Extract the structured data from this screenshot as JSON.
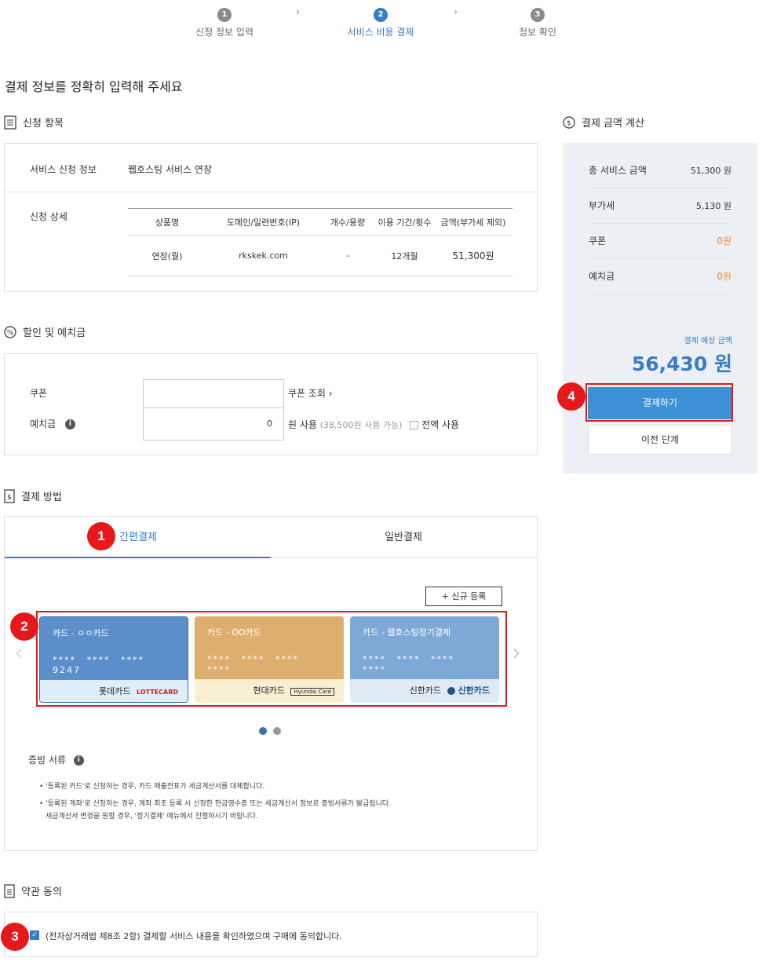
{
  "steps": [
    {
      "num": "1",
      "label": "신청 정보 입력"
    },
    {
      "num": "2",
      "label": "서비스 비용 결제"
    },
    {
      "num": "3",
      "label": "정보 확인"
    }
  ],
  "page_title": "결제 정보를 정확히 입력해 주세요",
  "sections": {
    "apply": "신청 항목",
    "discount": "할인 및 예치금",
    "method": "결제 방법",
    "terms": "약관 동의",
    "calc": "결제 금액 계산"
  },
  "apply": {
    "service_label": "서비스 신청 정보",
    "service_value": "웹호스팅 서비스 연장",
    "detail_label": "신청 상세",
    "columns": [
      "상품명",
      "도메인/일련번호(IP)",
      "개수/용량",
      "이용 기간/횟수",
      "금액(부가세 제외)"
    ],
    "row": [
      "연장(월)",
      "rkskek.com",
      "-",
      "12개월",
      "51,300원"
    ]
  },
  "discount": {
    "coupon_label": "쿠폰",
    "coupon_value": "",
    "coupon_lookup": "쿠폰 조회 ›",
    "deposit_label": "예치금",
    "deposit_value": "0",
    "deposit_use": "원 사용",
    "deposit_avail": "(38,500원 사용 가능)",
    "all_use": "전액 사용"
  },
  "method": {
    "tabs": [
      "간편결제",
      "일반결제"
    ],
    "new_register": "+ 신규 등록",
    "cards": [
      {
        "name": "카드 - ㅇㅇ카드",
        "number": "**** **** **** 9247",
        "issuer": "롯데카드",
        "brand": "LOTTECARD",
        "color": "#5b8fcb",
        "bottom": "#dfeefb"
      },
      {
        "name": "카드 - OO카드",
        "number": "**** **** **** ****",
        "issuer": "현대카드",
        "brand": "Hyundai Card",
        "color": "#deae6e",
        "bottom": "#fbefd2"
      },
      {
        "name": "카드 - 웹호스팅정기결제",
        "number": "**** **** **** ****",
        "issuer": "신한카드",
        "brand": "신한카드",
        "color": "#7ea8d6",
        "bottom": "#dfeaf5"
      }
    ],
    "proof_title": "증빙 서류",
    "proof_lines": [
      "• '등록된 카드'로 신청하는 경우, 카드 매출전표가 세금계산서를 대체합니다.",
      "• '등록된 계좌'로 신청하는 경우, 계좌 최초 등록 시 신청한 현금영수증 또는 세금계산서 정보로 증빙서류가 발급됩니다.",
      "세금계산서 변경을 원할 경우, '정기결제' 메뉴에서 진행하시기 바랍니다."
    ]
  },
  "terms": {
    "text": "(전자상거래법 제8조 2항) 결제할 서비스 내용을 확인하였으며 구매에 동의합니다.",
    "checked": true
  },
  "summary": {
    "rows": [
      {
        "label": "총 서비스 금액",
        "value": "51,300 원"
      },
      {
        "label": "부가세",
        "value": "5,130 원"
      },
      {
        "label": "쿠폰",
        "value": "0원"
      },
      {
        "label": "예치금",
        "value": "0원"
      }
    ],
    "expected_label": "결제 예상 금액",
    "expected_value": "56,430 원",
    "pay": "결제하기",
    "prev": "이전 단계"
  },
  "badges": [
    "1",
    "2",
    "3",
    "4"
  ],
  "colors": {
    "accent": "#3a7cc4",
    "orange": "#f08a3c",
    "red": "#e5191c"
  }
}
